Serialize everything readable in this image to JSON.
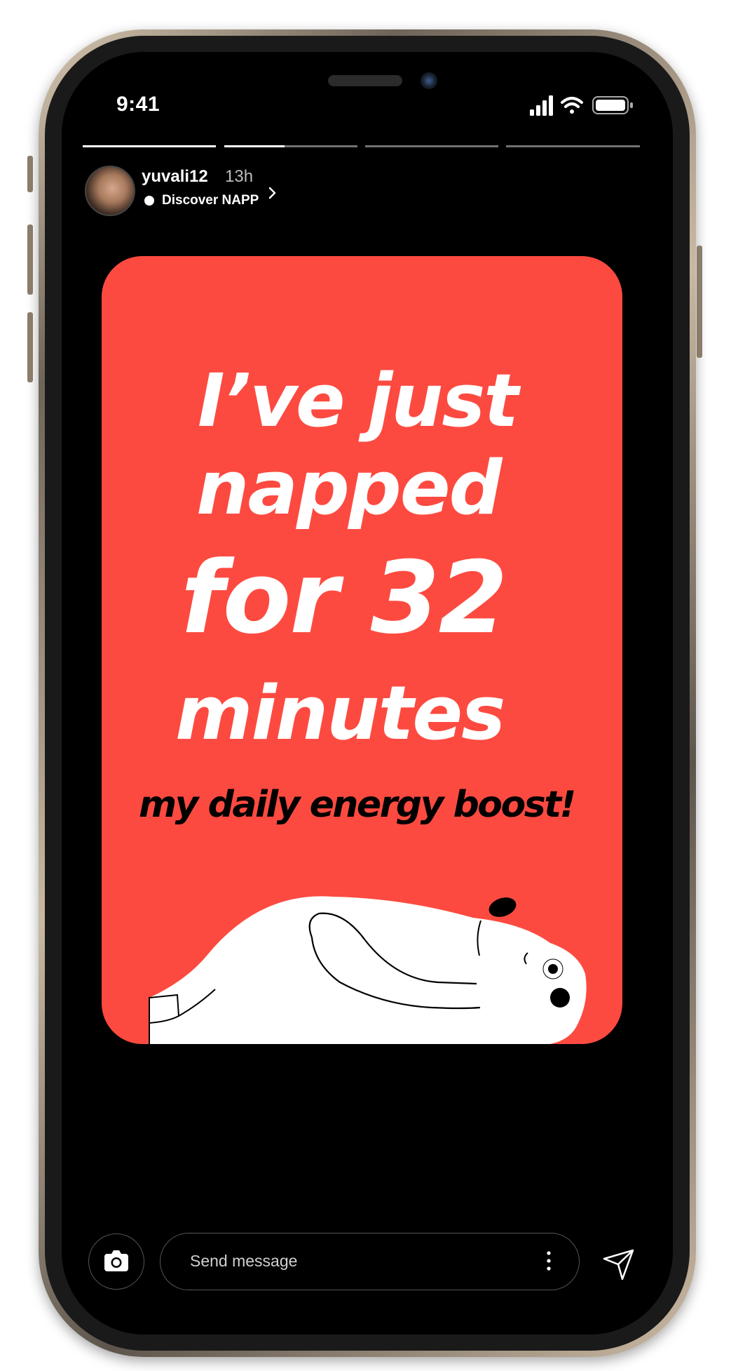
{
  "status_bar": {
    "time": "9:41"
  },
  "story": {
    "progress": [
      1.0,
      0.45,
      0.0,
      0.0
    ],
    "user": {
      "username": "yuvali12",
      "time_ago": "13h",
      "sponsored_label": "Discover NAPP"
    }
  },
  "card": {
    "background_color": "#fd4a40",
    "lines": [
      "I’ve just",
      "napped",
      "for 32",
      "minutes"
    ],
    "subline": "my daily energy boost!"
  },
  "composer": {
    "placeholder": "Send message"
  },
  "icons": {
    "camera": "camera-icon",
    "more": "more-vertical-icon",
    "send": "send-icon",
    "chevron": "chevron-right-icon"
  }
}
